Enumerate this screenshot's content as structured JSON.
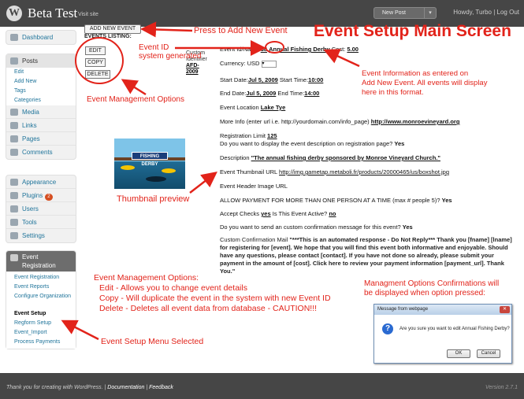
{
  "topbar": {
    "site_title": "Beta Test",
    "visit_site": "← Visit site",
    "new_post": "New Post",
    "howdy": "Howdy,",
    "separator": "|",
    "turbo": "Turbo",
    "logout": "Log Out"
  },
  "sidebar": {
    "dashboard": "Dashboard",
    "posts": "Posts",
    "posts_sub": [
      "Edit",
      "Add New",
      "Tags",
      "Categories"
    ],
    "media": "Media",
    "links": "Links",
    "pages": "Pages",
    "comments": "Comments",
    "appearance": "Appearance",
    "plugins": "Plugins",
    "plugins_count": "2",
    "users": "Users",
    "tools": "Tools",
    "settings": "Settings",
    "event_registration": "Event Registration",
    "event_sub": [
      "Event Registration",
      "Event Reports",
      "Configure Organization",
      "Event Setup",
      "Regform Setup",
      "Event_Import",
      "Process Payments"
    ]
  },
  "main": {
    "add_new_event": "ADD NEW EVENT",
    "events_listing": "EVENTS LISTING:",
    "edit": "EDIT",
    "copy": "COPY",
    "delete": "DELETE",
    "custom_identifier_label": "Custom Identifier",
    "custom_identifier_value": "AFD-2009",
    "event_id_name_label": "Event Id/Name",
    "event_id": "38",
    "event_name": "Annual Fishing Derby",
    "cost_label": "Cost:",
    "cost": "5.00",
    "currency_label": "Currency:",
    "currency": "USD",
    "start_date_label": "Start Date:",
    "start_date": "Jul 5, 2009",
    "start_time_label": "Start Time:",
    "start_time": "10:00",
    "end_date_label": "End Date:",
    "end_date": "Jul 5, 2009",
    "end_time_label": "End Time:",
    "end_time": "14:00",
    "location_label": "Event Location",
    "location": "Lake Tye",
    "more_info_label": "More Info (enter url i.e. http://yourdomain.com/info_page)",
    "more_info": "http://www.monroevineyard.org",
    "reg_limit_label": "Registration Limit",
    "reg_limit": "125",
    "display_desc_label": "Do you want to display the event description on registration page?",
    "display_desc": "Yes",
    "description_label": "Description",
    "description": "\"The annual fishing derby sponsored by Monroe Vineyard Church.\"",
    "thumb_url_label": "Event Thumbnail URL",
    "thumb_url": "http://img.gametap.metaboli.fr/products/20000465/us/boxshot.jpg",
    "header_image_label": "Event Header Image URL",
    "multi_pay_label": "ALLOW PAYMENT FOR MORE THAN ONE PERSON AT A TIME (max # people 5)?",
    "multi_pay": "Yes",
    "checks_label": "Accept Checks",
    "checks": "yes",
    "active_label": "Is This Event Active?",
    "active": "no",
    "confirm_label": "Do you want to send an custom confirmation message for this event?",
    "confirm": "Yes",
    "custom_mail_label": "Custom Confirmation Mail",
    "custom_mail": "\"***This is an automated response - Do Not Reply*** Thank you [fname] [lname] for registering for [event]. We hope that you will find this event both informative and enjoyable. Should have any questions, please contact [contact]. If you have not done so already, please submit your payment in the amount of [cost]. Click here to review your payment information [payment_url]. Thank You.\"",
    "thumbnail_banner": "FISHING DERBY"
  },
  "annotations": {
    "title": "Event Setup Main Screen",
    "press_add": "Press to Add New Event",
    "event_id_line1": "Event ID",
    "event_id_line2": "system generated",
    "mgmt_options": "Event Management Options",
    "info_line1": "Event Information as entered on",
    "info_line2": "Add New Event.  All events will display",
    "info_line3": "here in this format.",
    "thumbnail_preview": "Thumbnail preview",
    "opts_title": "Event Management Options:",
    "opts_edit": "Edit - Allows you to change event details",
    "opts_copy": "Copy - Will duplicate the event in the system with new Event ID",
    "opts_delete": "Delete - Deletes all event data from database - CAUTION!!!",
    "confirm_line1": "Managment Options Confirmations will",
    "confirm_line2": "be displayed when option pressed:",
    "menu_selected": "Event Setup Menu Selected"
  },
  "dialog": {
    "title": "Message from webpage",
    "message": "Are you sure you want to edit Annual Fishing Derby?",
    "ok": "OK",
    "cancel": "Cancel"
  },
  "footer": {
    "left_thanks": "Thank you for creating with WordPress.",
    "sep": "|",
    "documentation": "Documentation",
    "feedback": "Feedback",
    "version": "Version 2.7.1"
  },
  "colors": {
    "admin_bar": "#464646",
    "annotation": "#e2231a",
    "link": "#21759b"
  }
}
